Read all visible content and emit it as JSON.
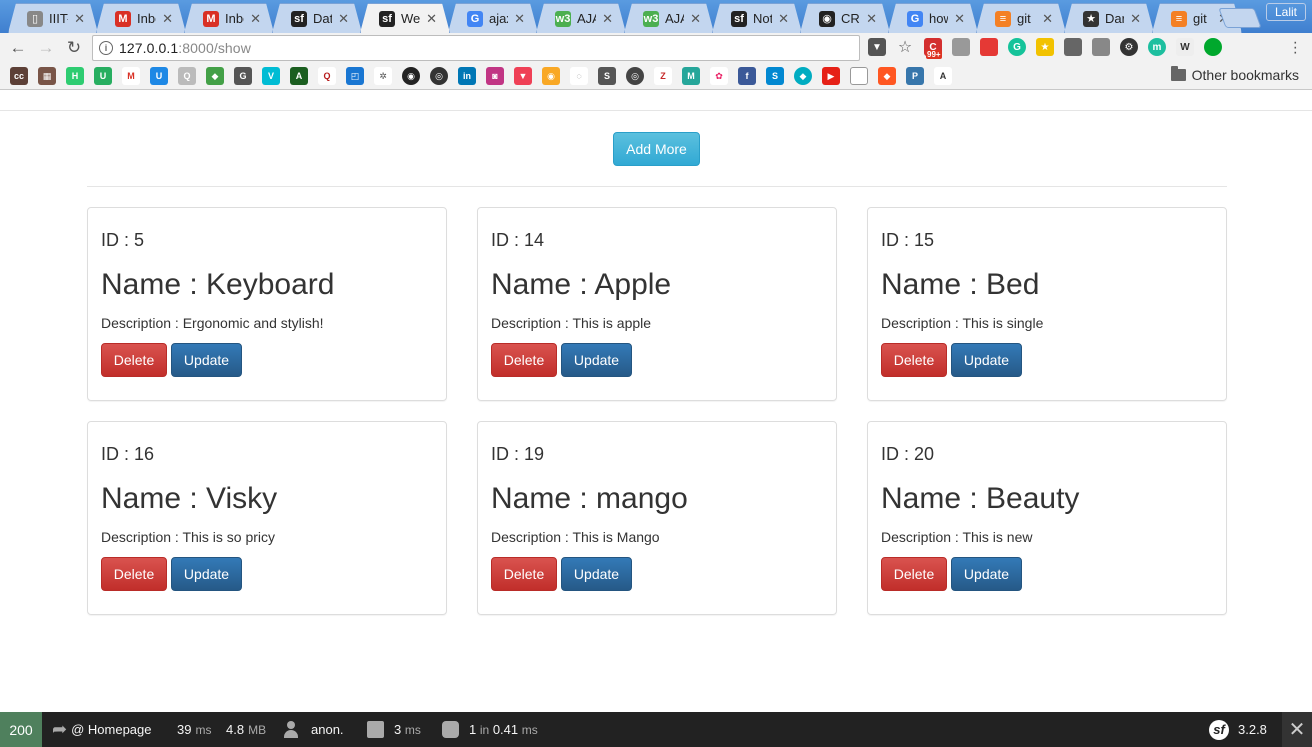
{
  "browser": {
    "tabs": [
      {
        "title": "IIIT-",
        "icon": "page-icon",
        "color": "#888888",
        "glyph": "▯"
      },
      {
        "title": "Inbo",
        "icon": "gmail-icon",
        "color": "#d93025",
        "glyph": "M"
      },
      {
        "title": "Inbo",
        "icon": "gmail-icon",
        "color": "#d93025",
        "glyph": "M"
      },
      {
        "title": "Dat",
        "icon": "symfony-icon",
        "color": "#222222",
        "glyph": "sf"
      },
      {
        "title": "Wel",
        "icon": "symfony-icon",
        "color": "#222222",
        "glyph": "sf",
        "active": true
      },
      {
        "title": "ajax",
        "icon": "google-icon",
        "color": "#4285f4",
        "glyph": "G"
      },
      {
        "title": "AJA",
        "icon": "w3schools-icon",
        "color": "#4caf50",
        "glyph": "w3"
      },
      {
        "title": "AJA",
        "icon": "w3schools-icon",
        "color": "#4caf50",
        "glyph": "w3"
      },
      {
        "title": "Not",
        "icon": "symfony-icon",
        "color": "#222222",
        "glyph": "sf"
      },
      {
        "title": "CRU",
        "icon": "github-icon",
        "color": "#222222",
        "glyph": "◉"
      },
      {
        "title": "how",
        "icon": "google-icon",
        "color": "#4285f4",
        "glyph": "G"
      },
      {
        "title": "git",
        "icon": "stackoverflow-icon",
        "color": "#f48024",
        "glyph": "≡"
      },
      {
        "title": "Dar",
        "icon": "star-icon",
        "color": "#333333",
        "glyph": "★"
      },
      {
        "title": "git",
        "icon": "stackoverflow-icon",
        "color": "#f48024",
        "glyph": "≡"
      }
    ],
    "profile": "Lalit",
    "url_host": "127.0.0.1",
    "url_path": ":8000/show",
    "extension_badge": "99+",
    "other_bookmarks": "Other bookmarks"
  },
  "page": {
    "add_more_label": "Add More",
    "delete_label": "Delete",
    "update_label": "Update",
    "items": [
      {
        "id": "ID : 5",
        "name": "Name : Keyboard",
        "description": "Description : Ergonomic and stylish!"
      },
      {
        "id": "ID : 14",
        "name": "Name : Apple",
        "description": "Description : This is apple"
      },
      {
        "id": "ID : 15",
        "name": "Name : Bed",
        "description": "Description : This is single"
      },
      {
        "id": "ID : 16",
        "name": "Name : Visky",
        "description": "Description : This is so pricy"
      },
      {
        "id": "ID : 19",
        "name": "Name : mango",
        "description": "Description : This is Mango"
      },
      {
        "id": "ID : 20",
        "name": "Name : Beauty",
        "description": "Description : This is new"
      }
    ]
  },
  "debug_toolbar": {
    "status": "200",
    "route": "@ Homepage",
    "time_value": "39",
    "time_unit": "ms",
    "memory_value": "4.8",
    "memory_unit": "MB",
    "user": "anon.",
    "twig_value": "3",
    "twig_unit": "ms",
    "db_queries": "1",
    "db_in": "in",
    "db_time": "0.41",
    "db_unit": "ms",
    "version": "3.2.8"
  }
}
